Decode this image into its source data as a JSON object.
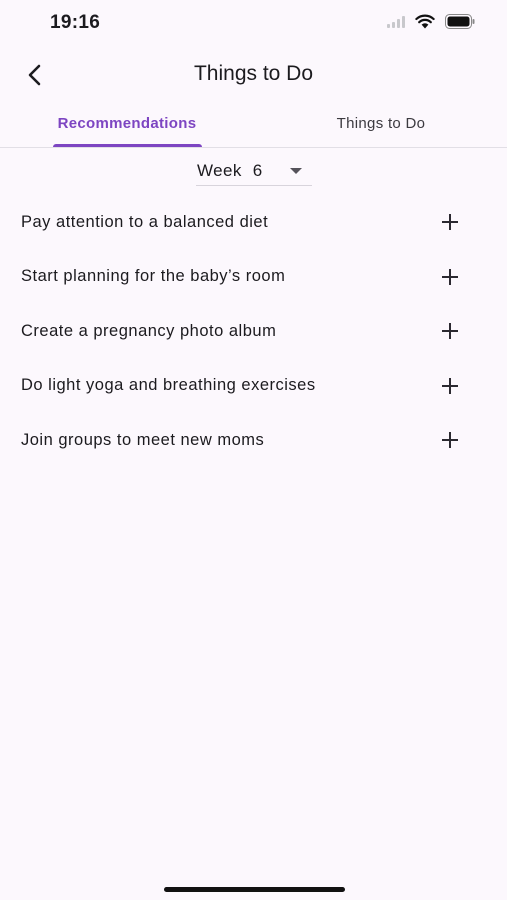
{
  "status_bar": {
    "time": "19:16",
    "icons": [
      "signal-icon",
      "wifi-icon",
      "battery-icon"
    ]
  },
  "app_bar": {
    "title": "Things to Do",
    "back_icon": "back-arrow-icon"
  },
  "tabs": [
    {
      "label": "Recommendations",
      "selected": true
    },
    {
      "label": "Things to Do",
      "selected": false
    }
  ],
  "week_selector": {
    "label": "Week",
    "value": "6",
    "icon": "dropdown-arrow-icon"
  },
  "tasks": [
    {
      "text": "Pay attention to a balanced diet",
      "icon": "plus-icon"
    },
    {
      "text": "Start planning for the baby’s room",
      "icon": "plus-icon"
    },
    {
      "text": "Create a pregnancy photo album",
      "icon": "plus-icon"
    },
    {
      "text": "Do light yoga and breathing exercises",
      "icon": "plus-icon"
    },
    {
      "text": "Join groups to meet new moms",
      "icon": "plus-icon"
    }
  ],
  "colors": {
    "accent": "#7d45c2",
    "background": "#fcf8fd",
    "text": "#1c1b1f"
  }
}
